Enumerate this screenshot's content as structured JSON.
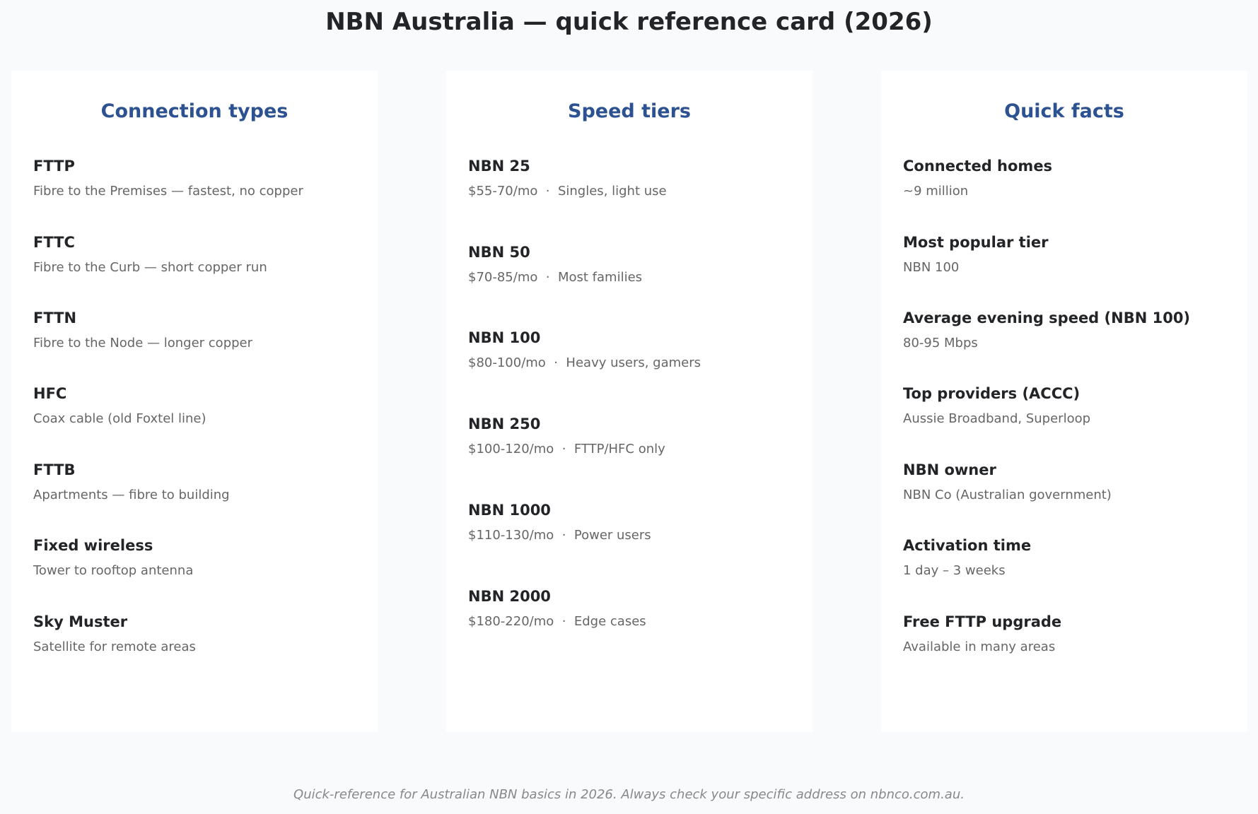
{
  "title": "NBN Australia — quick reference card (2026)",
  "columns": [
    {
      "heading": "Connection types",
      "items": [
        {
          "name": "FTTP",
          "detail": "Fibre to the Premises — fastest, no copper"
        },
        {
          "name": "FTTC",
          "detail": "Fibre to the Curb — short copper run"
        },
        {
          "name": "FTTN",
          "detail": "Fibre to the Node — longer copper"
        },
        {
          "name": "HFC",
          "detail": "Coax cable (old Foxtel line)"
        },
        {
          "name": "FTTB",
          "detail": "Apartments — fibre to building"
        },
        {
          "name": "Fixed wireless",
          "detail": "Tower to rooftop antenna"
        },
        {
          "name": "Sky Muster",
          "detail": "Satellite for remote areas"
        }
      ]
    },
    {
      "heading": "Speed tiers",
      "items": [
        {
          "name": "NBN 25",
          "detail": "$55-70/mo  ·  Singles, light use"
        },
        {
          "name": "NBN 50",
          "detail": "$70-85/mo  ·  Most families"
        },
        {
          "name": "NBN 100",
          "detail": "$80-100/mo  ·  Heavy users, gamers"
        },
        {
          "name": "NBN 250",
          "detail": "$100-120/mo  ·  FTTP/HFC only"
        },
        {
          "name": "NBN 1000",
          "detail": "$110-130/mo  ·  Power users"
        },
        {
          "name": "NBN 2000",
          "detail": "$180-220/mo  ·  Edge cases"
        }
      ]
    },
    {
      "heading": "Quick facts",
      "items": [
        {
          "name": "Connected homes",
          "detail": "~9 million"
        },
        {
          "name": "Most popular tier",
          "detail": "NBN 100"
        },
        {
          "name": "Average evening speed (NBN 100)",
          "detail": "80-95 Mbps"
        },
        {
          "name": "Top providers (ACCC)",
          "detail": "Aussie Broadband, Superloop"
        },
        {
          "name": "NBN owner",
          "detail": "NBN Co (Australian government)"
        },
        {
          "name": "Activation time",
          "detail": "1 day – 3 weeks"
        },
        {
          "name": "Free FTTP upgrade",
          "detail": "Available in many areas"
        }
      ]
    }
  ],
  "footer": "Quick-reference for Australian NBN basics in 2026. Always check your specific address on nbnco.com.au."
}
